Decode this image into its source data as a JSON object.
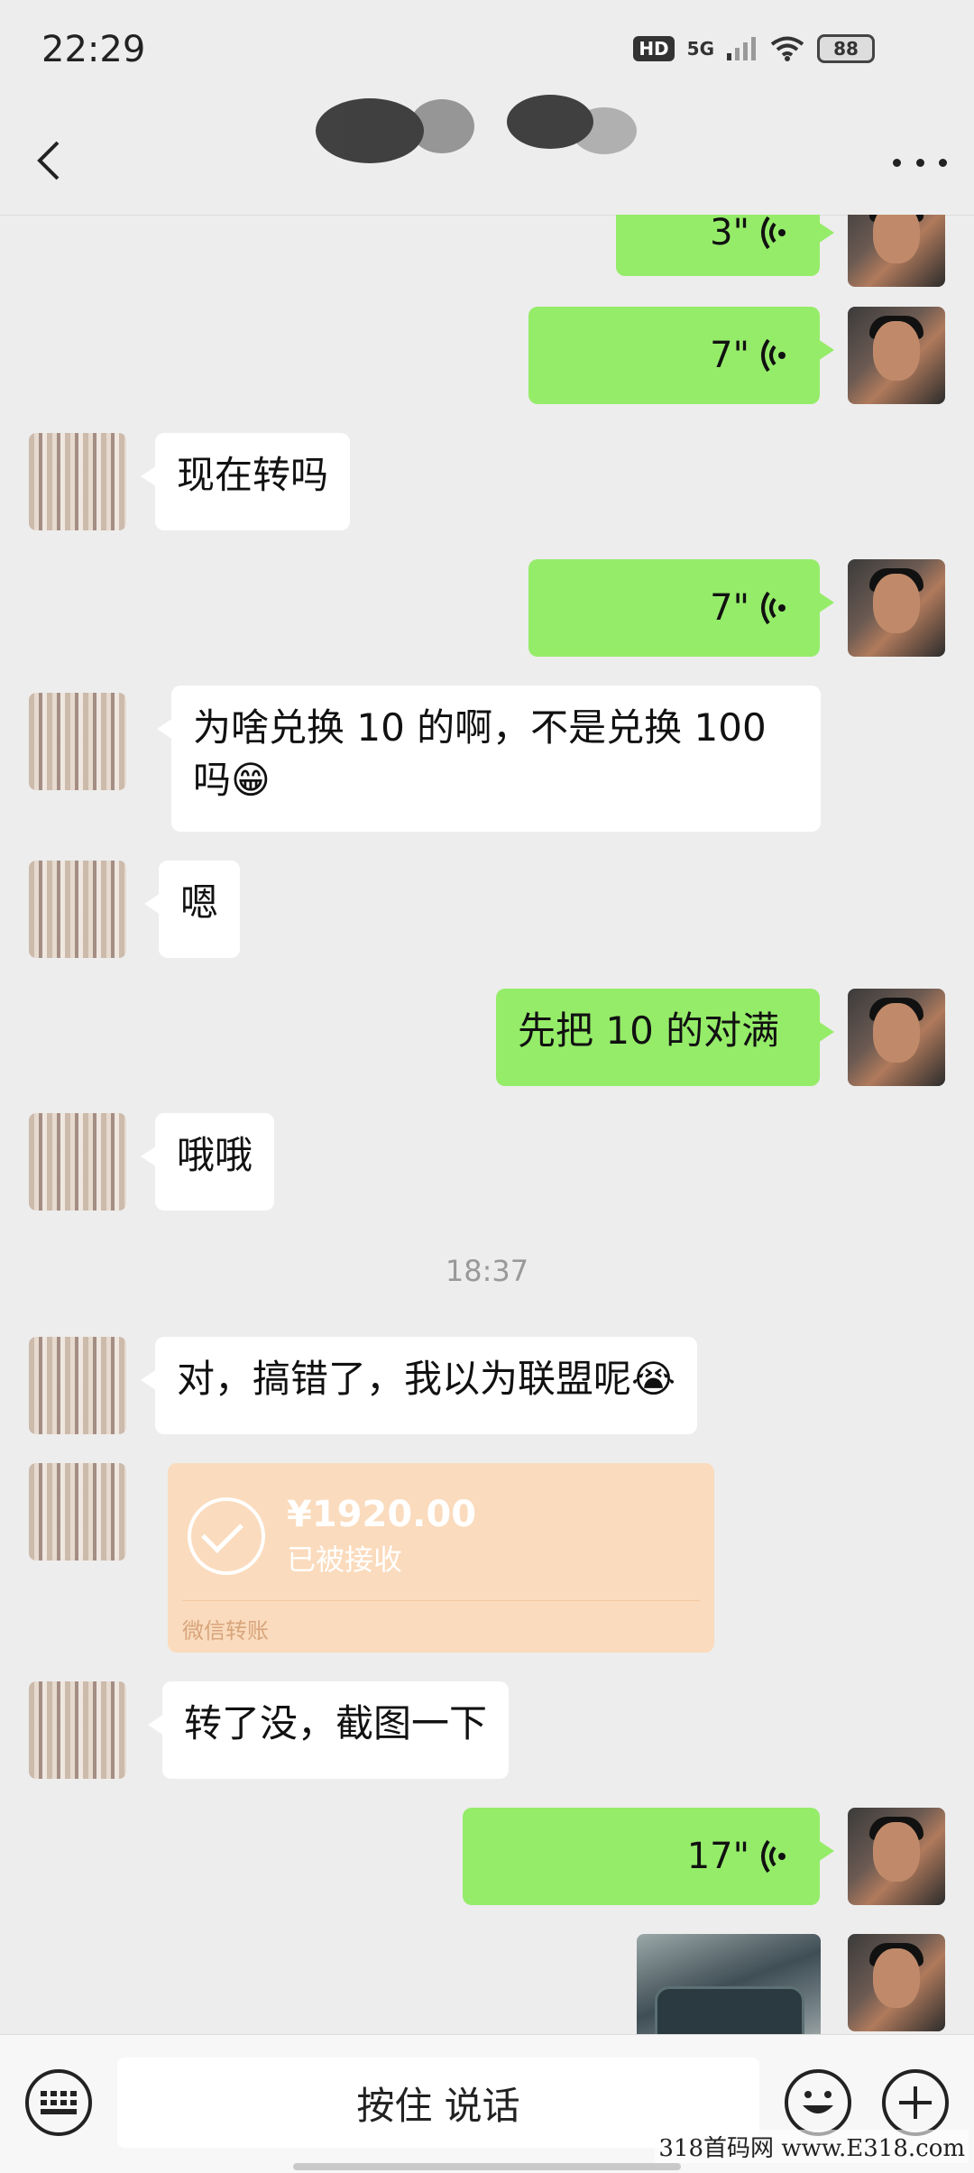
{
  "status_bar": {
    "time": "22:29",
    "hd": "HD",
    "network": "5G",
    "battery": "88"
  },
  "nav": {
    "back_icon": "chevron-left-icon",
    "more_icon": "more-dots-icon"
  },
  "messages": [
    {
      "type": "voice",
      "side": "right",
      "duration": "3\""
    },
    {
      "type": "voice",
      "side": "right",
      "duration": "7\""
    },
    {
      "type": "text",
      "side": "left",
      "text": "现在转吗"
    },
    {
      "type": "voice",
      "side": "right",
      "duration": "7\""
    },
    {
      "type": "text",
      "side": "left",
      "text": "为啥兑换 10 的啊，不是兑换 100 吗😁"
    },
    {
      "type": "text",
      "side": "left",
      "text": "嗯"
    },
    {
      "type": "text",
      "side": "right",
      "text": "先把 10 的对满"
    },
    {
      "type": "text",
      "side": "left",
      "text": "哦哦"
    },
    {
      "type": "time",
      "text": "18:37"
    },
    {
      "type": "text",
      "side": "left",
      "text": "对，搞错了，我以为联盟呢😭"
    },
    {
      "type": "transfer",
      "side": "left",
      "amount": "¥1920.00",
      "status": "已被接收",
      "label": "微信转账"
    },
    {
      "type": "text",
      "side": "left",
      "text": "转了没，截图一下"
    },
    {
      "type": "voice",
      "side": "right",
      "duration": "17\""
    },
    {
      "type": "image",
      "side": "right"
    }
  ],
  "input_bar": {
    "hold_to_talk": "按住 说话"
  },
  "watermark": "318首码网 www.E318.com"
}
